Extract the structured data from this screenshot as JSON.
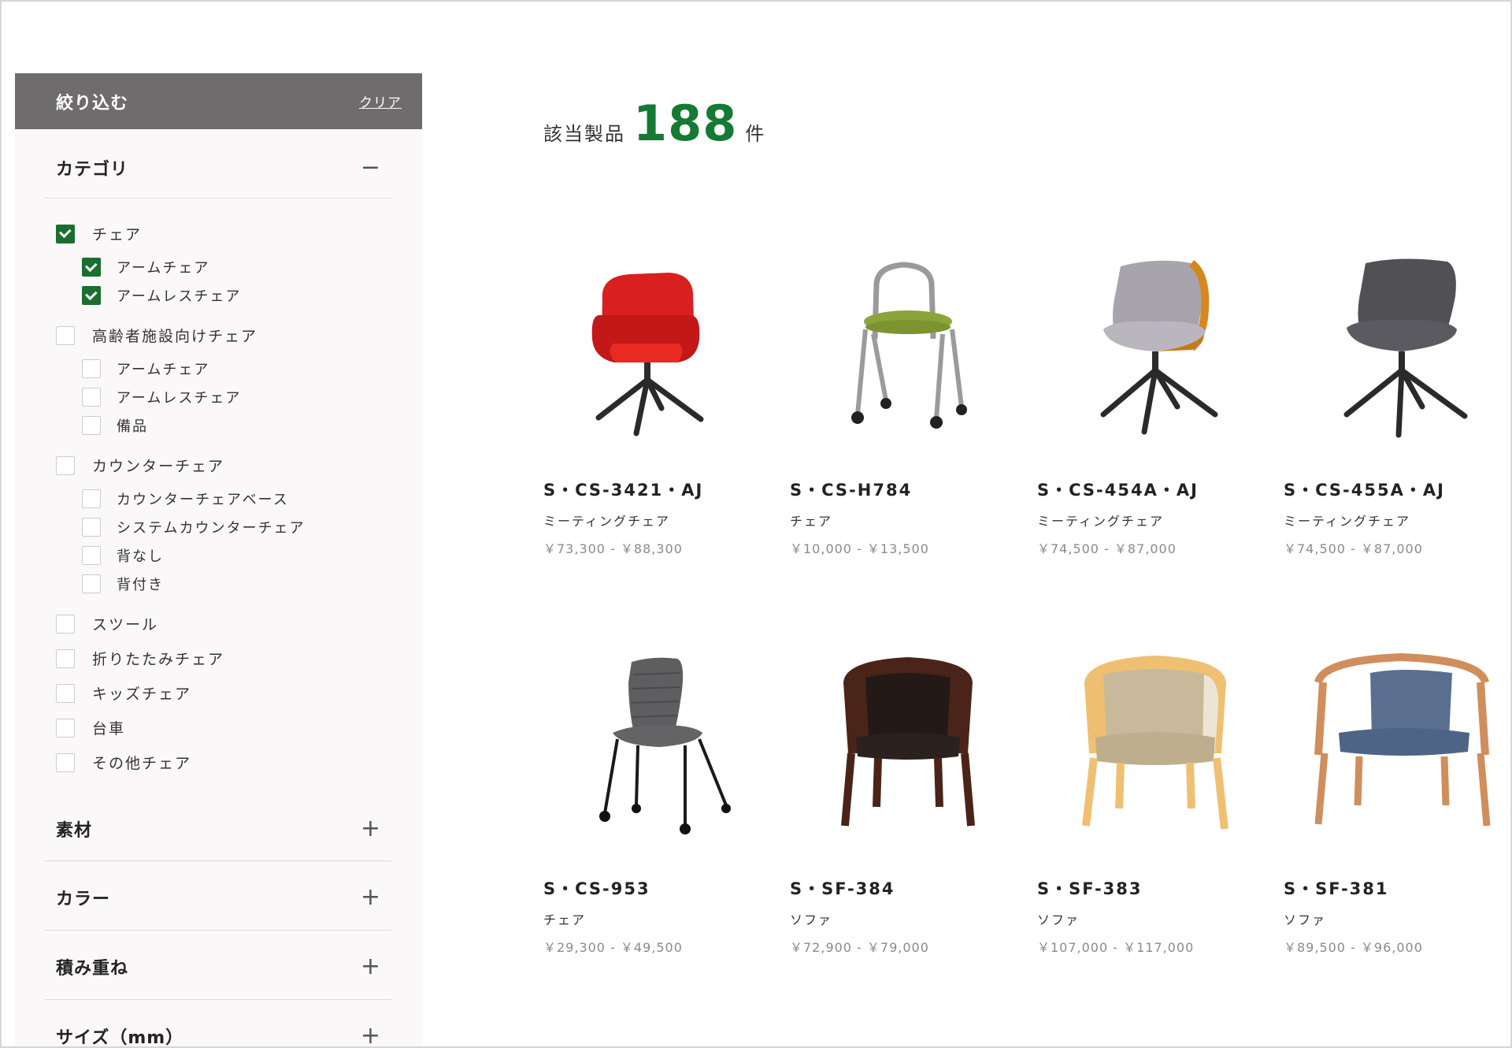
{
  "filter": {
    "title": "絞り込む",
    "clear_label": "クリア",
    "category": {
      "label": "カテゴリ",
      "toggle": "−",
      "options": {
        "chair": "チェア",
        "chair_arm": "アームチェア",
        "chair_armless": "アームレスチェア",
        "elderly": "高齢者施設向けチェア",
        "elderly_arm": "アームチェア",
        "elderly_armless": "アームレスチェア",
        "elderly_supplies": "備品",
        "counter": "カウンターチェア",
        "counter_base": "カウンターチェアベース",
        "counter_system": "システムカウンターチェア",
        "counter_noback": "背なし",
        "counter_back": "背付き",
        "stool": "スツール",
        "folding": "折りたたみチェア",
        "kids": "キッズチェア",
        "cart": "台車",
        "other": "その他チェア"
      },
      "checked": [
        "chair",
        "chair_arm",
        "chair_armless"
      ]
    },
    "sections": {
      "material": {
        "label": "素材",
        "toggle": "+"
      },
      "color": {
        "label": "カラー",
        "toggle": "+"
      },
      "stacking": {
        "label": "積み重ね",
        "toggle": "+"
      },
      "size": {
        "label": "サイズ（mm）",
        "toggle": "+"
      }
    }
  },
  "results": {
    "prefix": "該当製品",
    "count": "188",
    "suffix": "件"
  },
  "products": [
    {
      "name": "S・CS-3421・AJ",
      "category": "ミーティングチェア",
      "price": "￥73,300 - ￥88,300",
      "image_icon": "red-swivel-armchair"
    },
    {
      "name": "S・CS-H784",
      "category": "チェア",
      "price": "￥10,000 - ￥13,500",
      "image_icon": "green-seat-caster-chair"
    },
    {
      "name": "S・CS-454A・AJ",
      "category": "ミーティングチェア",
      "price": "￥74,500 - ￥87,000",
      "image_icon": "grey-orange-swivel-chair"
    },
    {
      "name": "S・CS-455A・AJ",
      "category": "ミーティングチェア",
      "price": "￥74,500 - ￥87,000",
      "image_icon": "charcoal-swivel-chair"
    },
    {
      "name": "S・CS-953",
      "category": "チェア",
      "price": "￥29,300 - ￥49,500",
      "image_icon": "grey-quilted-caster-chair"
    },
    {
      "name": "S・SF-384",
      "category": "ソファ",
      "price": "￥72,900 - ￥79,000",
      "image_icon": "dark-wood-armchair"
    },
    {
      "name": "S・SF-383",
      "category": "ソファ",
      "price": "￥107,000 - ￥117,000",
      "image_icon": "beige-wood-armchair"
    },
    {
      "name": "S・SF-381",
      "category": "ソファ",
      "price": "￥89,500 - ￥96,000",
      "image_icon": "blue-wood-armchair"
    }
  ],
  "colors": {
    "accent_green": "#157a32",
    "checkbox_green": "#1a6e2e",
    "filter_header": "#6e6c6c"
  }
}
